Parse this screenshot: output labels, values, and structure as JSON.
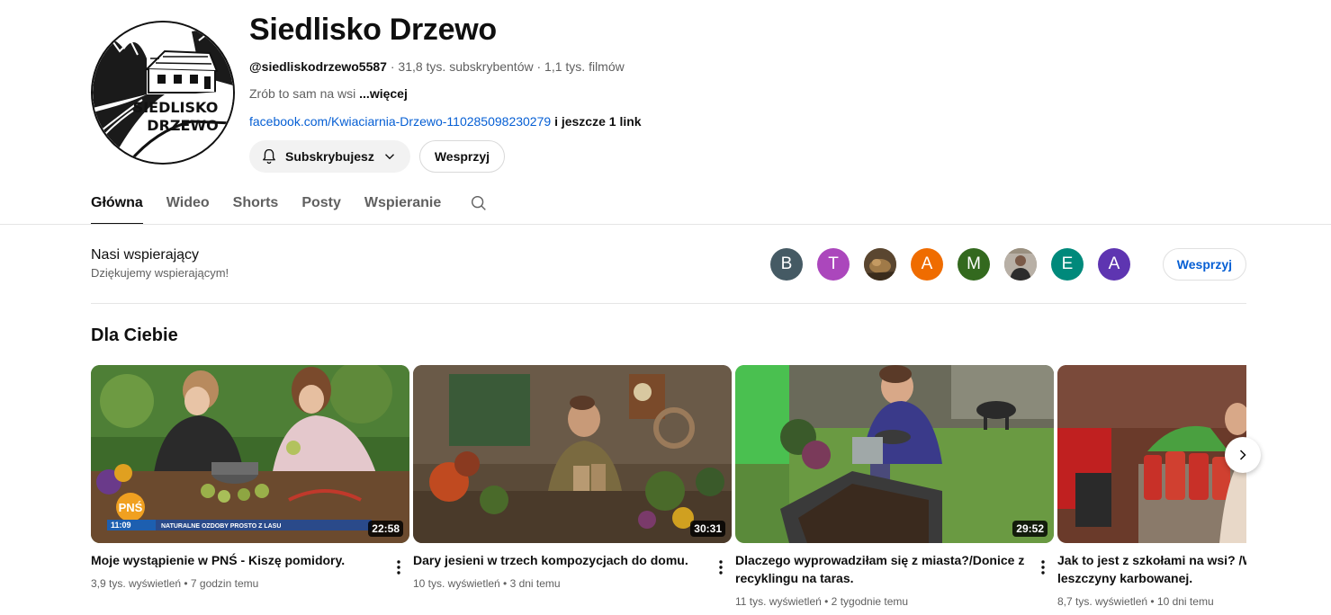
{
  "channel": {
    "name": "Siedlisko Drzewo",
    "handle": "@siedliskodrzewo5587",
    "subscribers": "31,8 tys. subskrybentów",
    "videos": "1,1 tys. filmów",
    "separator": "·",
    "description": "Zrób to sam na wsi",
    "more_label": "...więcej",
    "link": "facebook.com/Kwiaciarnia-Drzewo-110285098230279",
    "extra_links": "i jeszcze 1 link",
    "logo_text_top": "SIEDLISKO",
    "logo_text_bottom": "DRZEWO"
  },
  "actions": {
    "subscribed_label": "Subskrybujesz",
    "support_label": "Wesprzyj"
  },
  "tabs": [
    {
      "label": "Główna",
      "active": true
    },
    {
      "label": "Wideo"
    },
    {
      "label": "Shorts"
    },
    {
      "label": "Posty"
    },
    {
      "label": "Wspieranie"
    }
  ],
  "supporters": {
    "title": "Nasi wspierający",
    "subtitle": "Dziękujemy wspierającym!",
    "button_label": "Wesprzyj",
    "avatars": [
      {
        "letter": "B",
        "color": "#455a64"
      },
      {
        "letter": "T",
        "color": "#ab47bc"
      },
      {
        "letter": "",
        "color": "#6d5a3a",
        "photo": true
      },
      {
        "letter": "A",
        "color": "#ef6c00"
      },
      {
        "letter": "M",
        "color": "#33691e"
      },
      {
        "letter": "",
        "color": "#8a7a6a",
        "photo": true
      },
      {
        "letter": "E",
        "color": "#00897b"
      },
      {
        "letter": "A",
        "color": "#5e35b1"
      }
    ]
  },
  "section": {
    "title": "Dla Ciebie"
  },
  "videos": [
    {
      "title": "Moje wystąpienie w PNŚ - Kiszę pomidory.",
      "meta": "3,9 tys. wyświetleń • 7 godzin temu",
      "duration": "22:58",
      "tv_logo": "PNŚ",
      "tv_ticker": "NATURALNE OZDOBY PROSTO Z LASU",
      "tv_time": "11:09"
    },
    {
      "title": "Dary jesieni w trzech kompozycjach do domu.",
      "meta": "10 tys. wyświetleń • 3 dni temu",
      "duration": "30:31"
    },
    {
      "title": "Dlaczego wyprowadziłam się z miasta?/Donice z recyklingu na taras.",
      "meta": "11 tys. wyświetleń • 2 tygodnie temu",
      "duration": "29:52"
    },
    {
      "title": "Jak to jest z szkołami na wsi? /Wazon z leszczyny karbowanej.",
      "meta": "8,7 tys. wyświetleń • 10 dni temu",
      "duration": ""
    }
  ],
  "colors": {
    "link": "#065fd4",
    "text_secondary": "#606060",
    "chip_bg": "#f2f2f2"
  }
}
